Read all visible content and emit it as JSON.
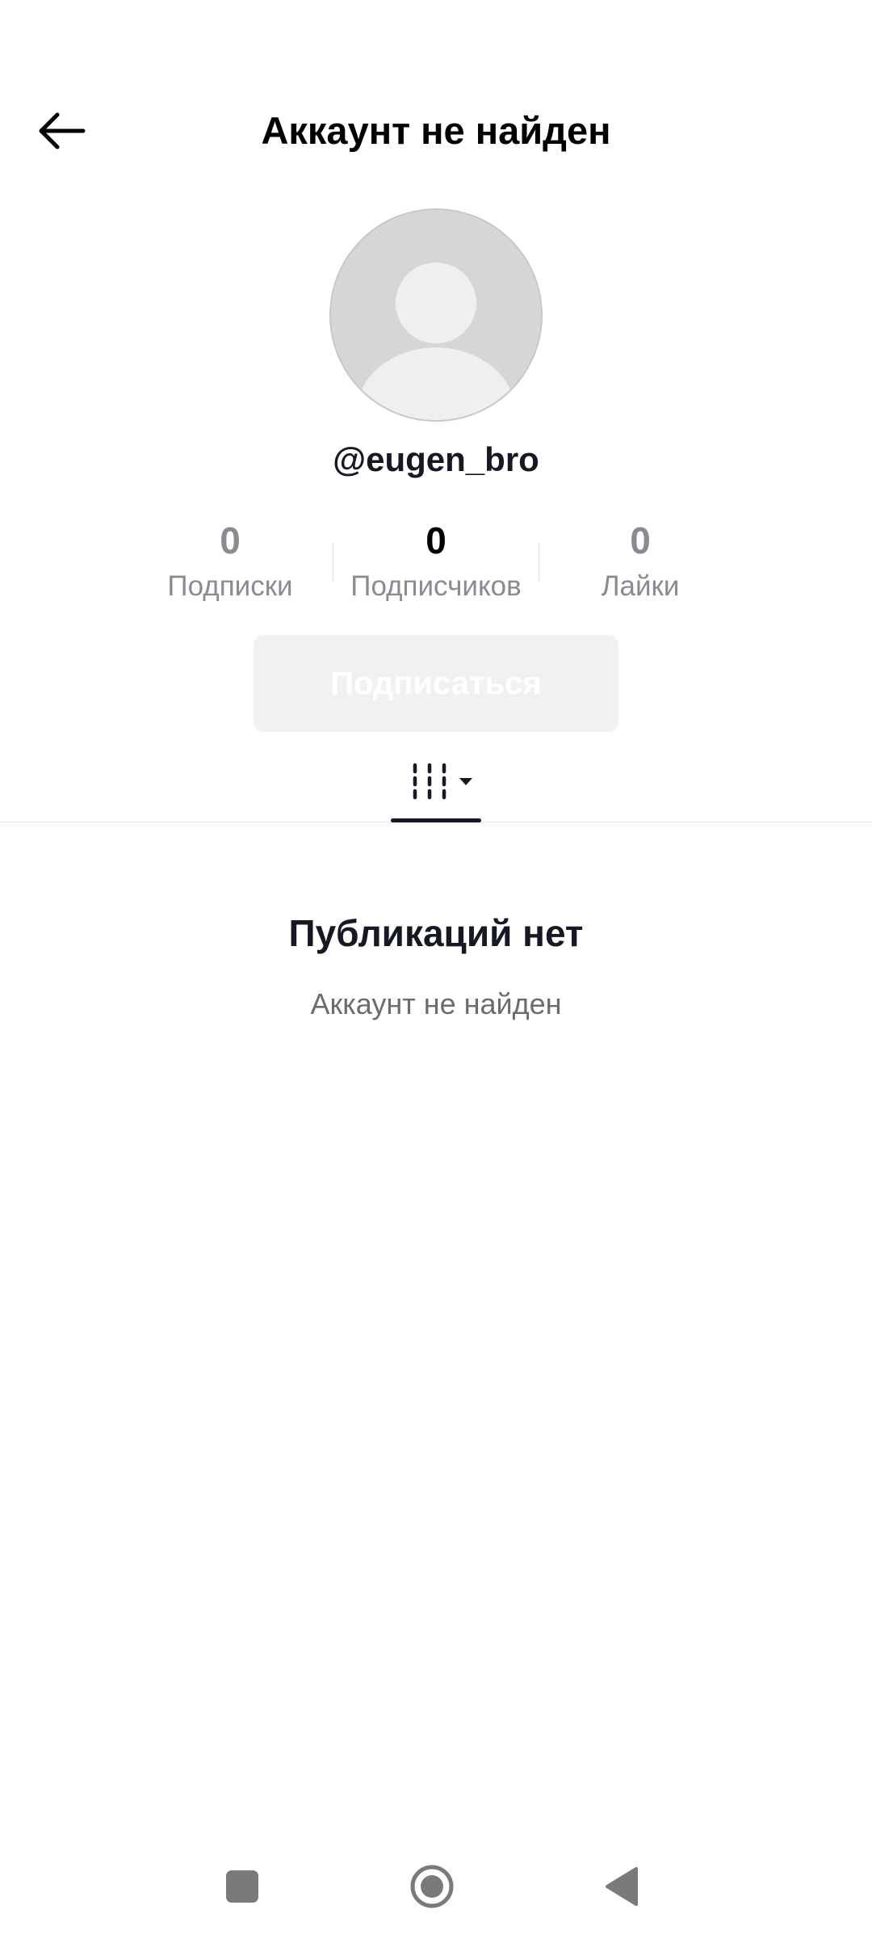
{
  "header": {
    "title": "Аккаунт не найден",
    "back_icon": "arrow-left-icon"
  },
  "profile": {
    "avatar_icon": "default-avatar-icon",
    "username": "@eugen_bro"
  },
  "stats": [
    {
      "value": "0",
      "label": "Подписки"
    },
    {
      "value": "0",
      "label": "Подписчиков"
    },
    {
      "value": "0",
      "label": "Лайки"
    }
  ],
  "follow_button": {
    "label": "Подписаться",
    "state": "disabled"
  },
  "tabs": {
    "active_icon": "videos-grid-dropdown-icon"
  },
  "empty_state": {
    "title": "Публикаций нет",
    "subtitle": "Аккаунт не найден"
  },
  "system_nav": {
    "recents_icon": "square-icon",
    "home_icon": "circle-icon",
    "back_icon": "triangle-back-icon"
  },
  "colors": {
    "text_primary": "#161823",
    "text_muted": "#8a8b91",
    "button_disabled_bg": "#f1f1f2",
    "avatar_bg": "#d6d6d6"
  }
}
